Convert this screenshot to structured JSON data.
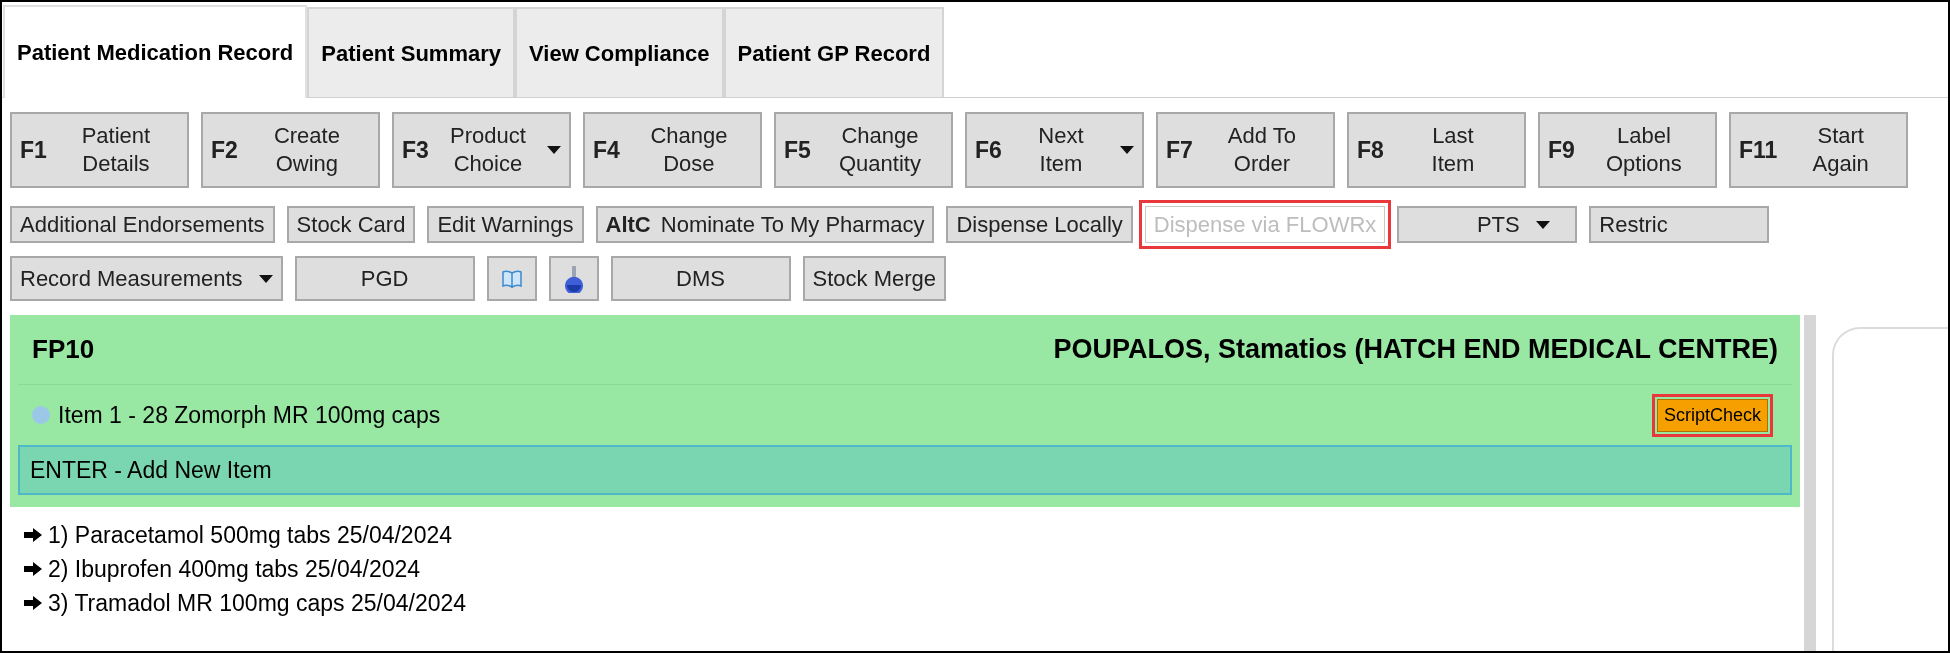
{
  "tabs": [
    {
      "label": "Patient Medication Record",
      "selected": true
    },
    {
      "label": "Patient Summary",
      "selected": false
    },
    {
      "label": "View Compliance",
      "selected": false
    },
    {
      "label": "Patient GP Record",
      "selected": false
    }
  ],
  "function_keys": [
    {
      "key": "F1",
      "lines": [
        "Patient",
        "Details"
      ],
      "dropdown": false
    },
    {
      "key": "F2",
      "lines": [
        "Create",
        "Owing"
      ],
      "dropdown": false
    },
    {
      "key": "F3",
      "lines": [
        "Product",
        "Choice"
      ],
      "dropdown": true
    },
    {
      "key": "F4",
      "lines": [
        "Change",
        "Dose"
      ],
      "dropdown": false
    },
    {
      "key": "F5",
      "lines": [
        "Change",
        "Quantity"
      ],
      "dropdown": false
    },
    {
      "key": "F6",
      "lines": [
        "Next",
        "Item"
      ],
      "dropdown": true
    },
    {
      "key": "F7",
      "lines": [
        "Add To",
        "Order"
      ],
      "dropdown": false
    },
    {
      "key": "F8",
      "lines": [
        "Last",
        "Item"
      ],
      "dropdown": false
    },
    {
      "key": "F9",
      "lines": [
        "Label",
        "Options"
      ],
      "dropdown": false
    },
    {
      "key": "F11",
      "lines": [
        "Start",
        "Again"
      ],
      "dropdown": false
    }
  ],
  "toolbar_1": [
    {
      "kind": "button",
      "label": "Additional Endorsements"
    },
    {
      "kind": "button",
      "label": "Stock Card"
    },
    {
      "kind": "button",
      "label": "Edit Warnings"
    },
    {
      "kind": "shortcut",
      "key": "AltC",
      "label": "Nominate To My Pharmacy"
    },
    {
      "kind": "button",
      "label": "Dispense Locally"
    },
    {
      "kind": "button",
      "label": "Dispense via FLOWRx",
      "disabled": true,
      "highlighted": true
    },
    {
      "kind": "dropdown",
      "label": "PTS"
    },
    {
      "kind": "button",
      "label": "Restric"
    }
  ],
  "toolbar_2": [
    {
      "kind": "dropdown",
      "label": "Record Measurements"
    },
    {
      "kind": "button",
      "label": "PGD"
    },
    {
      "kind": "book"
    },
    {
      "kind": "flask"
    },
    {
      "kind": "button",
      "label": "DMS"
    },
    {
      "kind": "button",
      "label": "Stock Merge"
    }
  ],
  "prescription": {
    "form": "FP10",
    "patient": "POUPALOS, Stamatios (HATCH END MEDICAL CENTRE)",
    "items": [
      {
        "label": "Item 1 - 28 Zomorph MR 100mg caps",
        "color": "#9cc8e8",
        "badge": "ScriptCheck",
        "badge_highlighted": true
      }
    ],
    "add_item": "ENTER - Add New Item"
  },
  "history": [
    "1) Paracetamol 500mg tabs 25/04/2024",
    "2) Ibuprofen 400mg tabs 25/04/2024",
    "3) Tramadol MR 100mg caps 25/04/2024"
  ]
}
